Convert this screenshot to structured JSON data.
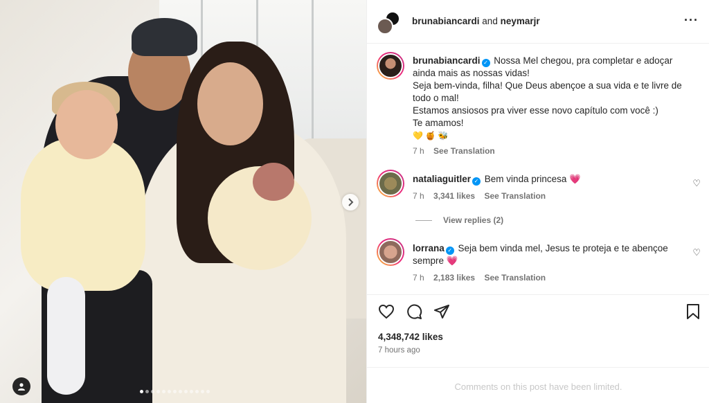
{
  "header": {
    "author": "brunabiancardi",
    "connector": "and",
    "coauthor": "neymarjr",
    "more_icon": "more-horizontal-icon"
  },
  "caption": {
    "username": "brunabiancardi",
    "lines": [
      "Nossa Mel chegou, pra completar e adoçar ainda mais as nossas vidas!",
      "Seja bem-vinda, filha! Que Deus abençoe a sua vida e te livre de todo o mal!",
      "Estamos ansiosos pra viver esse novo capítulo com você :)",
      "Te amamos!"
    ],
    "emojis": "💛 🍯 🐝",
    "time": "7 h",
    "translate": "See Translation"
  },
  "comments": [
    {
      "username": "nataliaguitler",
      "text": "Bem vinda princesa 💗",
      "time": "7 h",
      "likes": "3,341 likes",
      "translate": "See Translation"
    },
    {
      "username": "lorrana",
      "text": "Seja bem vinda mel, Jesus te proteja e te abençoe sempre 💗",
      "time": "7 h",
      "likes": "2,183 likes",
      "translate": "See Translation"
    }
  ],
  "view_replies": "View replies (2)",
  "post": {
    "likes": "4,348,742 likes",
    "posted": "7 hours ago",
    "limited": "Comments on this post have been limited."
  },
  "carousel": {
    "slide_count": 13,
    "active_index": 0
  },
  "colors": {
    "accent": "#0095f6",
    "story_ring_start": "#f9ce34",
    "story_ring_end": "#c13584"
  }
}
